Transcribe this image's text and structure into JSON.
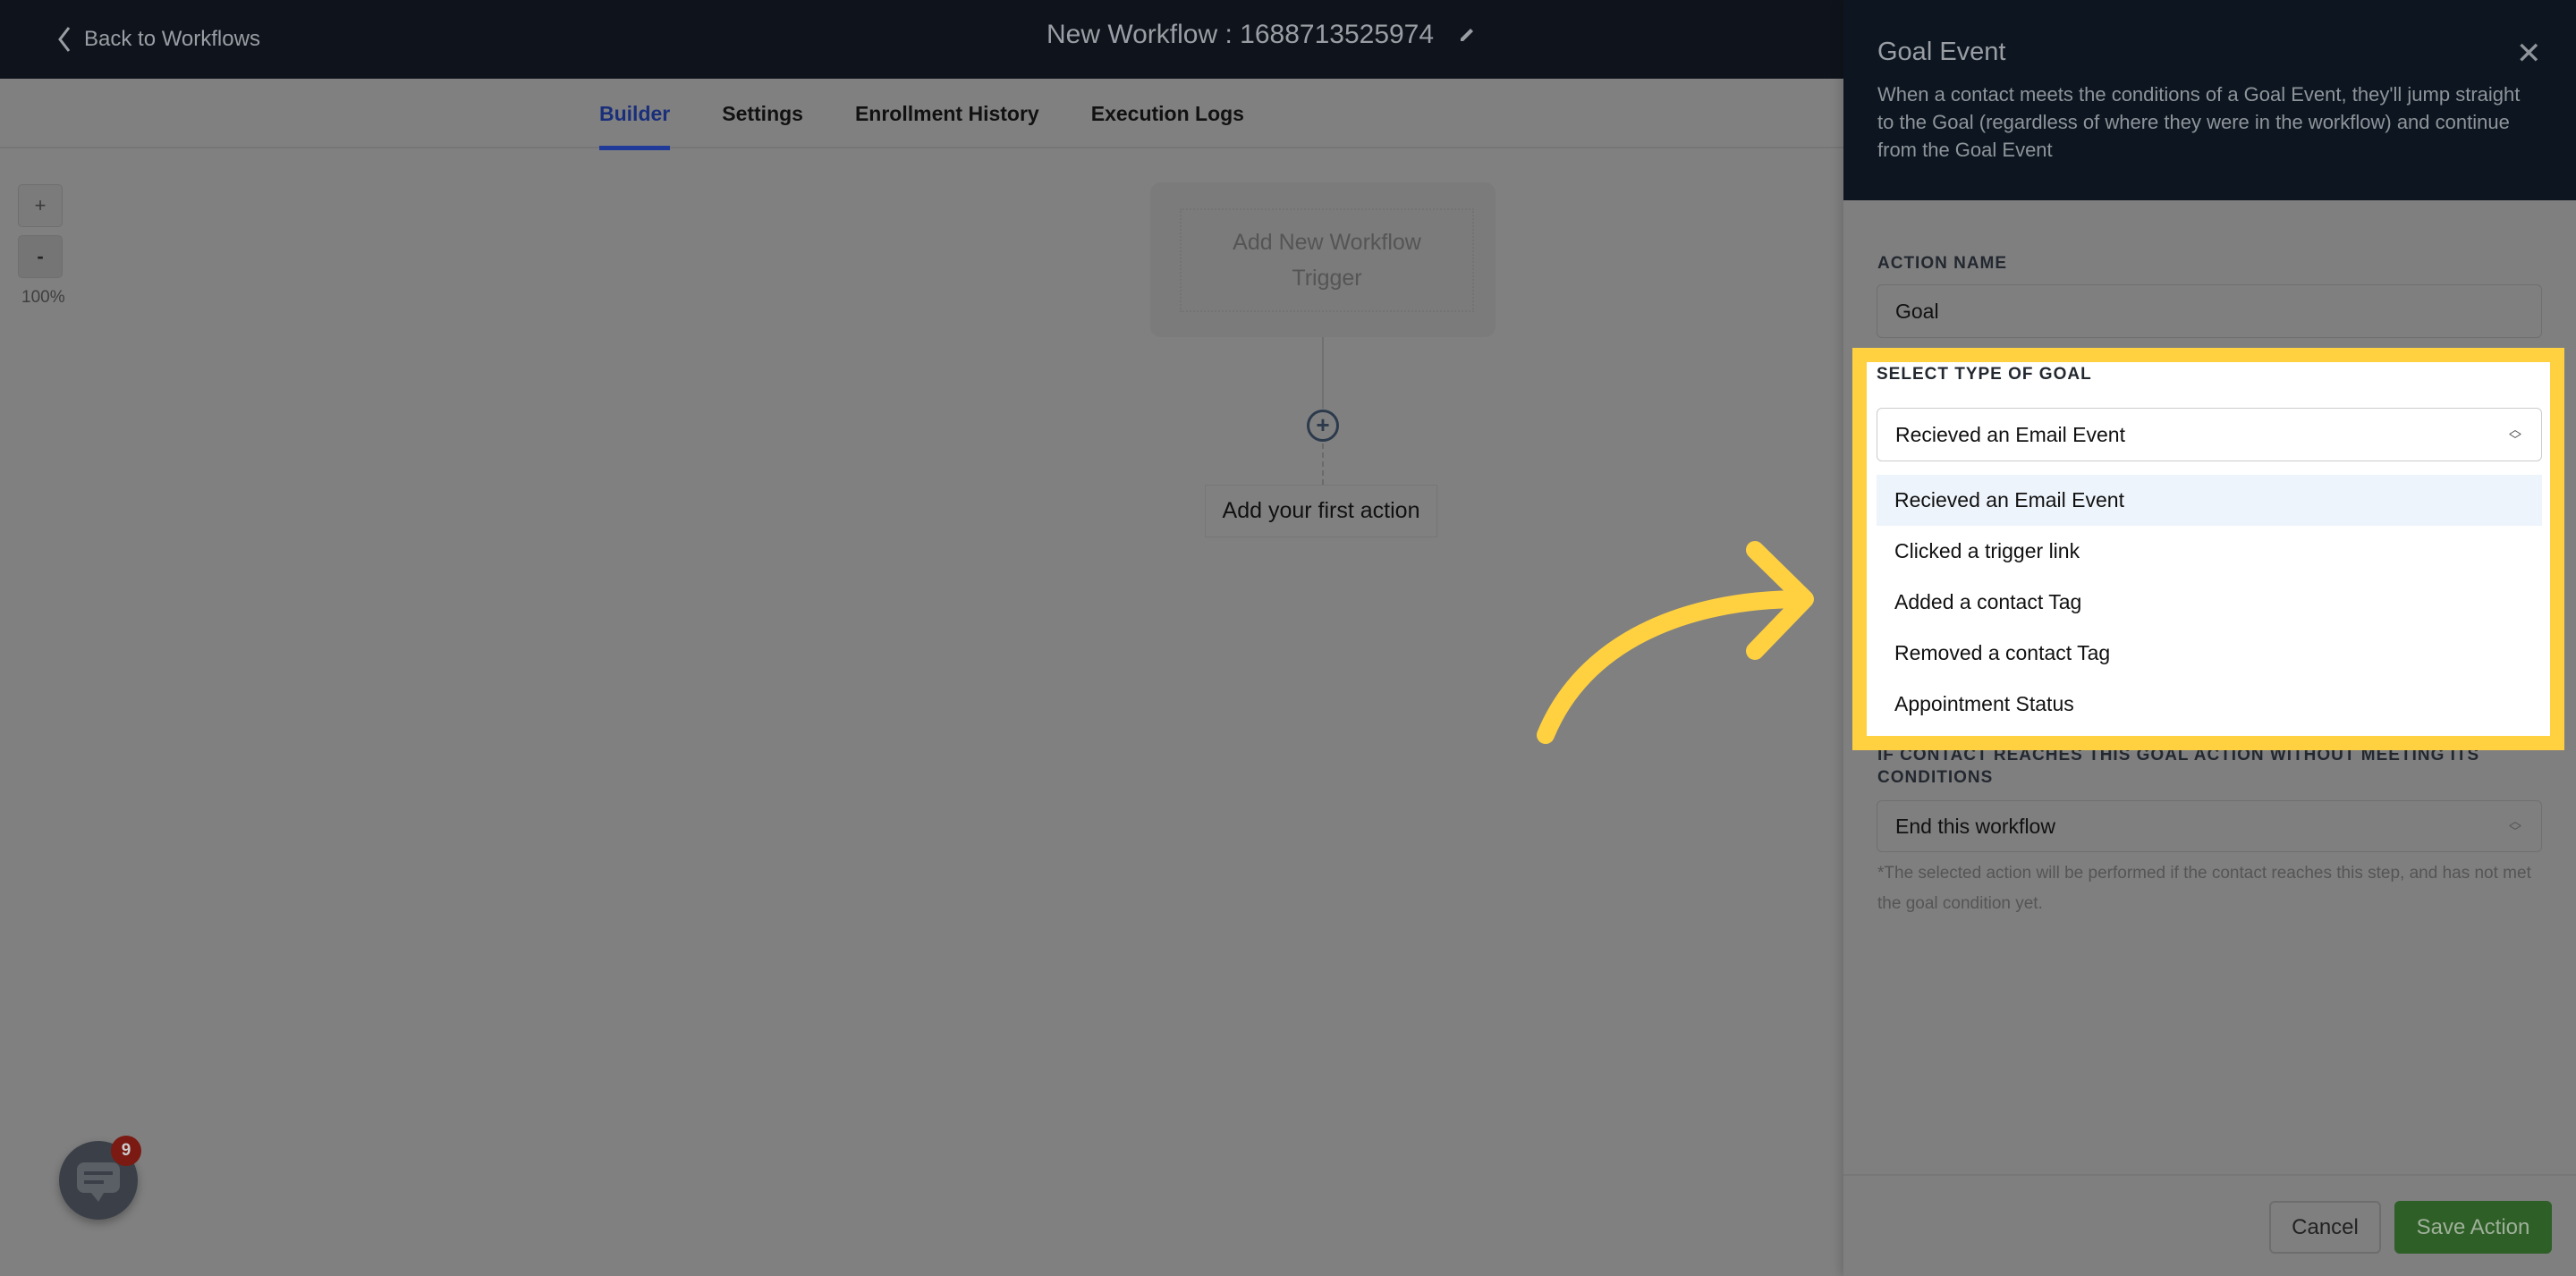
{
  "header": {
    "back_label": "Back to Workflows",
    "title": "New Workflow : 1688713525974",
    "edit_icon": "pencil-icon"
  },
  "tabs": [
    {
      "label": "Builder",
      "active": true
    },
    {
      "label": "Settings"
    },
    {
      "label": "Enrollment History"
    },
    {
      "label": "Execution Logs"
    }
  ],
  "canvas": {
    "zoom_in": "+",
    "zoom_out": "-",
    "zoom_level": "100%",
    "trigger_label": "Add New Workflow Trigger",
    "first_action": "Add your first action"
  },
  "chat": {
    "badge": "9"
  },
  "panel": {
    "title": "Goal Event",
    "description": "When a contact meets the conditions of a Goal Event, they'll jump straight to the Goal (regardless of where they were in the workflow) and continue from the Goal Event",
    "action_name_label": "ACTION NAME",
    "action_name_value": "Goal",
    "goal_type_label": "SELECT TYPE OF GOAL",
    "goal_type_value": "Recieved an Email Event",
    "goal_options": [
      "Recieved an Email Event",
      "Clicked a trigger link",
      "Added a contact Tag",
      "Removed a contact Tag",
      "Appointment Status"
    ],
    "fallback_label": "IF CONTACT REACHES THIS GOAL ACTION WITHOUT MEETING ITS CONDITIONS",
    "fallback_value": "End this workflow",
    "helper_text": "*The selected action will be performed if the contact reaches this step, and has not met the goal condition yet.",
    "cancel_label": "Cancel",
    "save_label": "Save Action"
  },
  "colors": {
    "highlight": "#ffd140",
    "save": "#4c9a3f",
    "header": "#0f141c",
    "active_tab": "#1f3a99"
  }
}
